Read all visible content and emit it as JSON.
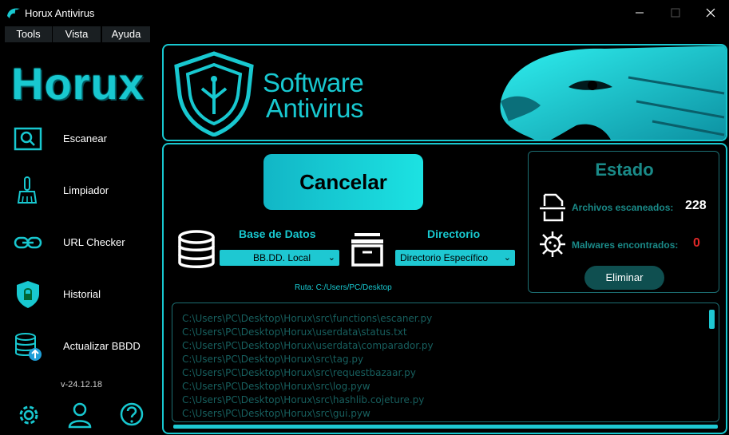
{
  "window": {
    "title": "Horux Antivirus"
  },
  "menu": {
    "items": [
      "Tools",
      "Vista",
      "Ayuda"
    ]
  },
  "sidebar": {
    "brand": "Horux",
    "items": [
      {
        "label": "Escanear",
        "icon": "scan-icon"
      },
      {
        "label": "Limpiador",
        "icon": "broom-icon"
      },
      {
        "label": "URL Checker",
        "icon": "link-icon"
      },
      {
        "label": "Historial",
        "icon": "shield-lock-icon"
      },
      {
        "label": "Actualizar BBDD",
        "icon": "database-update-icon"
      }
    ],
    "version": "v-24.12.18",
    "footer_icons": [
      "gear-icon",
      "user-icon",
      "help-icon"
    ]
  },
  "banner": {
    "line1": "Software",
    "line2": "Antivirus"
  },
  "scan": {
    "cancel_label": "Cancelar",
    "db_title": "Base de Datos",
    "db_selected": "BB.DD. Local",
    "dir_title": "Directorio",
    "dir_selected": "Directorio Específico",
    "ruta": "Ruta: C:/Users/PC/Desktop"
  },
  "estado": {
    "title": "Estado",
    "files_label": "Archivos escaneados:",
    "files_value": "228",
    "malware_label": "Malwares encontrados:",
    "malware_value": "0",
    "delete_label": "Eliminar"
  },
  "log": {
    "lines": [
      "C:\\Users\\PC\\Desktop\\Horux\\src\\functions\\escaner.py",
      "C:\\Users\\PC\\Desktop\\Horux\\userdata\\status.txt",
      "C:\\Users\\PC\\Desktop\\Horux\\userdata\\comparador.py",
      "C:\\Users\\PC\\Desktop\\Horux\\src\\tag.py",
      "C:\\Users\\PC\\Desktop\\Horux\\src\\requestbazaar.py",
      "C:\\Users\\PC\\Desktop\\Horux\\src\\log.pyw",
      "C:\\Users\\PC\\Desktop\\Horux\\src\\hashlib.cojeture.py",
      "C:\\Users\\PC\\Desktop\\Horux\\src\\gui.pyw"
    ]
  },
  "colors": {
    "accent": "#18c8d0",
    "dark_teal": "#1a8a88",
    "danger": "#e02828",
    "background": "#000000"
  }
}
